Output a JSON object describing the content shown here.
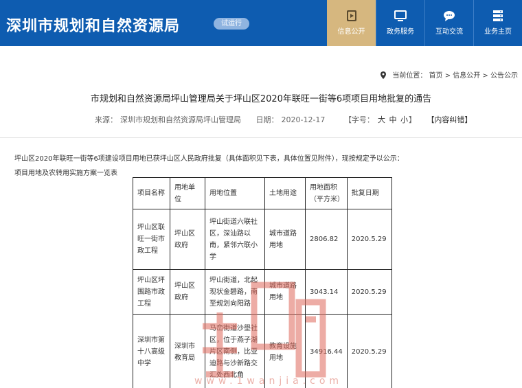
{
  "header": {
    "site_title": "深圳市规划和自然资源局",
    "trial_badge": "试运行",
    "nav": [
      {
        "label": "信息公开",
        "icon": "video-icon",
        "active": true
      },
      {
        "label": "政务服务",
        "icon": "monitor-icon",
        "active": false
      },
      {
        "label": "互动交流",
        "icon": "chat-icon",
        "active": false
      },
      {
        "label": "业务主页",
        "icon": "server-icon",
        "active": false
      }
    ]
  },
  "breadcrumb": {
    "prefix": "当前位置：",
    "path": "首页 > 信息公开 > 公告公示"
  },
  "article": {
    "title": "市规划和自然资源局坪山管理局关于坪山区2020年联旺一街等6项项目用地批复的通告",
    "source_label": "来源：",
    "source": "深圳市规划和自然资源局坪山管理局",
    "date_label": "日期：",
    "date": "2020-12-17",
    "font_size_label": "【字号：",
    "font_large": "大",
    "font_medium": "中",
    "font_small": "小",
    "font_size_close": "】",
    "errata": "【内容纠错】",
    "intro": "坪山区2020年联旺一街等6项建设项目用地已获坪山区人民政府批复（具体面积见下表，具体位置见附件），现按规定予以公示：",
    "table_caption": "项目用地及农转用实施方案一览表"
  },
  "table": {
    "headers": [
      "项目名称",
      "用地单位",
      "用地位置",
      "土地用途",
      "用地面积（平方米）",
      "批复日期"
    ],
    "rows": [
      [
        "坪山区联旺一街市政工程",
        "坪山区政府",
        "坪山街道六联社区，深汕路以南，紧邻六联小学",
        "城市道路用地",
        "2806.82",
        "2020.5.29"
      ],
      [
        "坪山区坪围路市政工程",
        "坪山区政府",
        "坪山街道，北起现状金碧路，南至规划向阳路",
        "城市道路用地",
        "3043.14",
        "2020.5.29"
      ],
      [
        "深圳市第十八高级中学",
        "深圳市教育局",
        "马峦街道沙壆社区，位于燕子湖片区南侧，比亚迪路与沙新路交汇处西北角",
        "教育设施用地",
        "34916.44",
        "2020.5.29"
      ]
    ]
  },
  "watermark": {
    "text": "www.1wanjia.com",
    "color": "#e06a5c"
  }
}
